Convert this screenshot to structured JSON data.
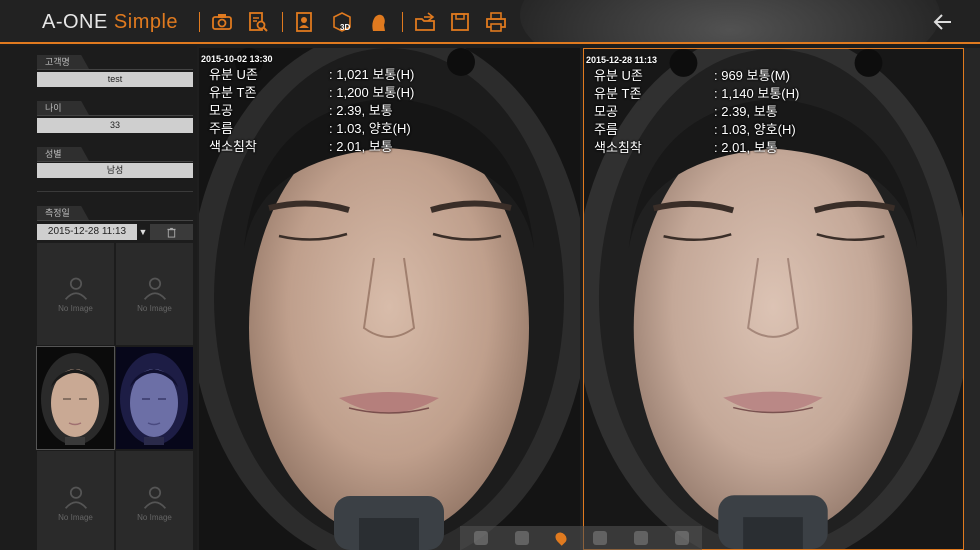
{
  "app": {
    "brand_main": "A-ONE",
    "brand_sub": "Simple"
  },
  "toolbar": {
    "icons": [
      "camera-icon",
      "report-search-icon",
      "profile-icon",
      "3d-view-icon",
      "face-silhouette-icon",
      "export-folder-icon",
      "save-icon",
      "print-icon"
    ],
    "threed_label": "3D",
    "accent": "#e07a1f"
  },
  "sidebar": {
    "name_label": "고객명",
    "name_value": "test",
    "age_label": "나이",
    "age_value": "33",
    "gender_label": "성별",
    "gender_value": "남성",
    "date_label": "측정일",
    "date_value": "2015-12-28 11:13",
    "no_image": "No Image"
  },
  "left_panel": {
    "timestamp": "2015-10-02 13:30",
    "metrics": [
      {
        "key": "유분 U존",
        "value": ": 1,021 보통(H)"
      },
      {
        "key": "유분 T존",
        "value": ": 1,200 보통(H)"
      },
      {
        "key": "모공",
        "value": ": 2.39, 보통"
      },
      {
        "key": "주름",
        "value": ": 1.03, 양호(H)"
      },
      {
        "key": "색소침착",
        "value": ": 2.01, 보통"
      }
    ]
  },
  "right_panel": {
    "timestamp": "2015-12-28 11:13",
    "metrics": [
      {
        "key": "유분 U존",
        "value": ": 969 보통(M)"
      },
      {
        "key": "유분 T존",
        "value": ": 1,140 보통(H)"
      },
      {
        "key": "모공",
        "value": ": 2.39, 보통"
      },
      {
        "key": "주름",
        "value": ": 1.03, 양호(H)"
      },
      {
        "key": "색소침착",
        "value": ": 2.01, 보통"
      }
    ]
  }
}
